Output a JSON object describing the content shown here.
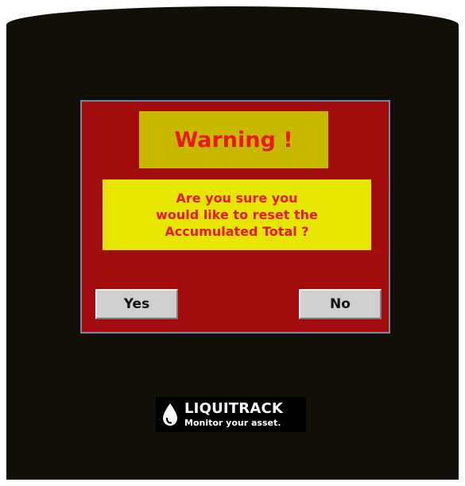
{
  "dialog": {
    "title": "Warning !",
    "message_lines": [
      "Are you sure you",
      "would like to reset the",
      "Accumulated Total ?"
    ],
    "yes_label": "Yes",
    "no_label": "No"
  },
  "branding": {
    "logo_name": "LIQUITRACK",
    "tagline": "Monitor your asset.",
    "logo_icon": "water-drop-icon"
  },
  "colors": {
    "screen_background": "#120f08",
    "dialog_background": "#a30c0c",
    "title_box": "#c8b800",
    "message_box": "#e6e600",
    "warning_text": "#e8191d",
    "button_face": "#cfcfcf"
  }
}
